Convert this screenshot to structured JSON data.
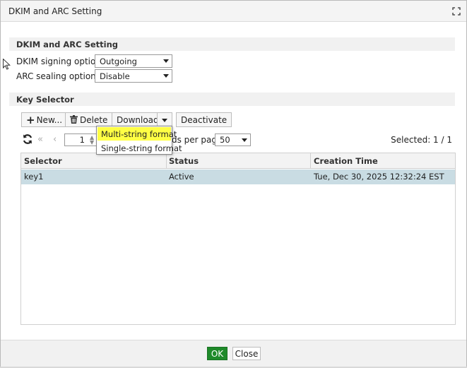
{
  "window": {
    "title": "DKIM and ARC Setting"
  },
  "settings_section": {
    "header": "DKIM and ARC Setting",
    "dkim": {
      "label": "DKIM signing option",
      "value": "Outgoing"
    },
    "arc": {
      "label": "ARC sealing option",
      "value": "Disable"
    }
  },
  "key_section": {
    "header": "Key Selector"
  },
  "toolbar": {
    "new_label": "New...",
    "delete_label": "Delete",
    "download_label": "Download",
    "deactivate_label": "Deactivate"
  },
  "download_menu": {
    "items": [
      "Multi-string format",
      "Single-string format"
    ],
    "highlighted_index": 0
  },
  "pager": {
    "page_value": "1",
    "per_page_label": "ds per page",
    "per_page_value": "50",
    "selected_label": "Selected: 1 / 1"
  },
  "table": {
    "columns": [
      "Selector",
      "Status",
      "Creation Time"
    ],
    "rows": [
      {
        "selector": "key1",
        "status": "Active",
        "creation_time": "Tue, Dec 30, 2025 12:32:24 EST"
      }
    ]
  },
  "footer": {
    "ok_label": "OK",
    "close_label": "Close"
  },
  "colors": {
    "ok_button": "#1f8a2a",
    "selected_row": "#c9dce3",
    "menu_highlight": "#ffff44"
  }
}
